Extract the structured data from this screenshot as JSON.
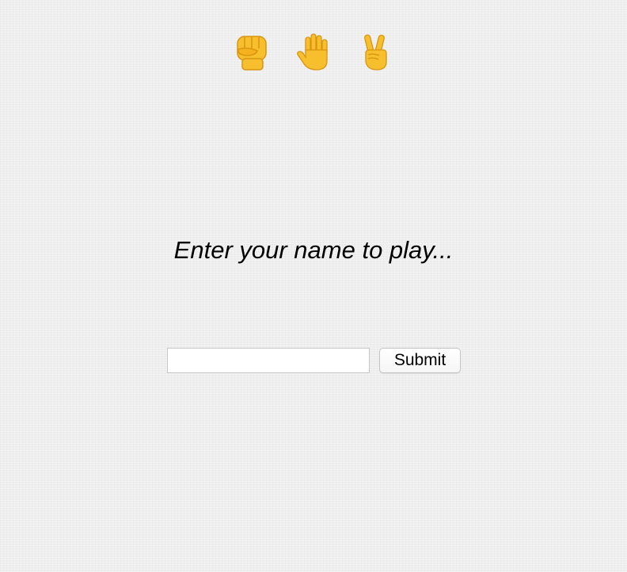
{
  "choices": [
    {
      "name": "rock",
      "icon": "raised-fist-icon"
    },
    {
      "name": "paper",
      "icon": "raised-hand-icon"
    },
    {
      "name": "scissors",
      "icon": "victory-hand-icon"
    }
  ],
  "prompt": "Enter your name to play...",
  "form": {
    "name_value": "",
    "name_placeholder": "",
    "submit_label": "Submit"
  },
  "colors": {
    "background": "#eeeeee",
    "emoji_skin": "#f7be2e",
    "emoji_shade": "#d9950f",
    "text": "#000000"
  }
}
